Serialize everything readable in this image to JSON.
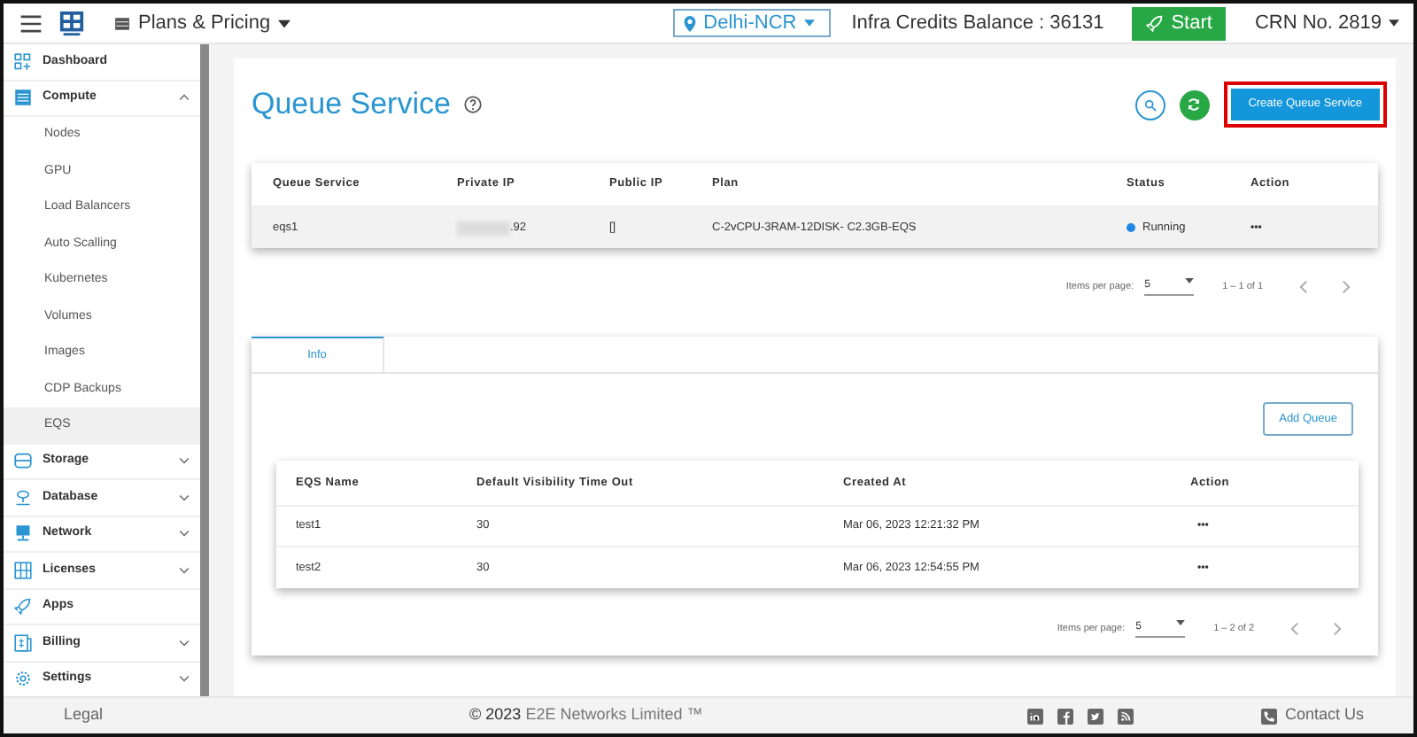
{
  "topbar": {
    "menu_label": "Plans & Pricing",
    "region": "Delhi-NCR",
    "credits": "Infra Credits Balance : 36131",
    "start_button": "Start",
    "account": "CRN No. 2819"
  },
  "sidebar": {
    "items": [
      {
        "label": "Dashboard",
        "kind": "section",
        "selected": false
      },
      {
        "label": "Compute",
        "kind": "section",
        "selected": false,
        "expanded": true,
        "children": [
          {
            "label": "Nodes",
            "selected": false
          },
          {
            "label": "GPU",
            "selected": false
          },
          {
            "label": "Load Balancers",
            "selected": false
          },
          {
            "label": "Auto Scalling",
            "selected": false
          },
          {
            "label": "Kubernetes",
            "selected": false
          },
          {
            "label": "Volumes",
            "selected": false
          },
          {
            "label": "Images",
            "selected": false
          },
          {
            "label": "CDP Backups",
            "selected": false
          },
          {
            "label": "EQS",
            "selected": true
          }
        ]
      },
      {
        "label": "Storage",
        "kind": "section",
        "selected": false,
        "expanded": false
      },
      {
        "label": "Database",
        "kind": "section",
        "selected": false,
        "expanded": false
      },
      {
        "label": "Network",
        "kind": "section",
        "selected": false,
        "expanded": false
      },
      {
        "label": "Licenses",
        "kind": "section",
        "selected": false,
        "expanded": false
      },
      {
        "label": "Apps",
        "kind": "section",
        "selected": false
      },
      {
        "label": "Billing",
        "kind": "section",
        "selected": false,
        "expanded": false
      },
      {
        "label": "Settings",
        "kind": "section",
        "selected": false,
        "expanded": false
      }
    ]
  },
  "page": {
    "title": "Queue Service",
    "create_button": "Create Queue Service"
  },
  "service_table": {
    "columns": [
      "Queue Service",
      "Private IP",
      "Public IP",
      "Plan",
      "Status",
      "Action"
    ],
    "rows": [
      {
        "name": "eqs1",
        "private_ip": ".92",
        "public_ip": "[]",
        "plan": "C-2vCPU-3RAM-12DISK- C2.3GB-EQS",
        "status": "Running",
        "action": "•••"
      }
    ],
    "pagination": {
      "label": "Items per page:",
      "page_size": "5",
      "range": "1 – 1 of 1"
    }
  },
  "tabs": [
    {
      "label": "Info",
      "selected": true
    }
  ],
  "queues": {
    "add_button": "Add Queue",
    "columns": [
      "EQS Name",
      "Default Visibility Time Out",
      "Created At",
      "Action"
    ],
    "rows": [
      {
        "name": "test1",
        "timeout": "30",
        "created": "Mar 06, 2023 12:21:32 PM",
        "action": "•••"
      },
      {
        "name": "test2",
        "timeout": "30",
        "created": "Mar 06, 2023 12:54:55 PM",
        "action": "•••"
      }
    ],
    "pagination": {
      "label": "Items per page:",
      "page_size": "5",
      "range": "1 – 2 of 2"
    }
  },
  "footer": {
    "legal": "Legal",
    "copyright_prefix": "© 2023",
    "company": "E2E Networks Limited ™",
    "contact": "Contact Us"
  }
}
